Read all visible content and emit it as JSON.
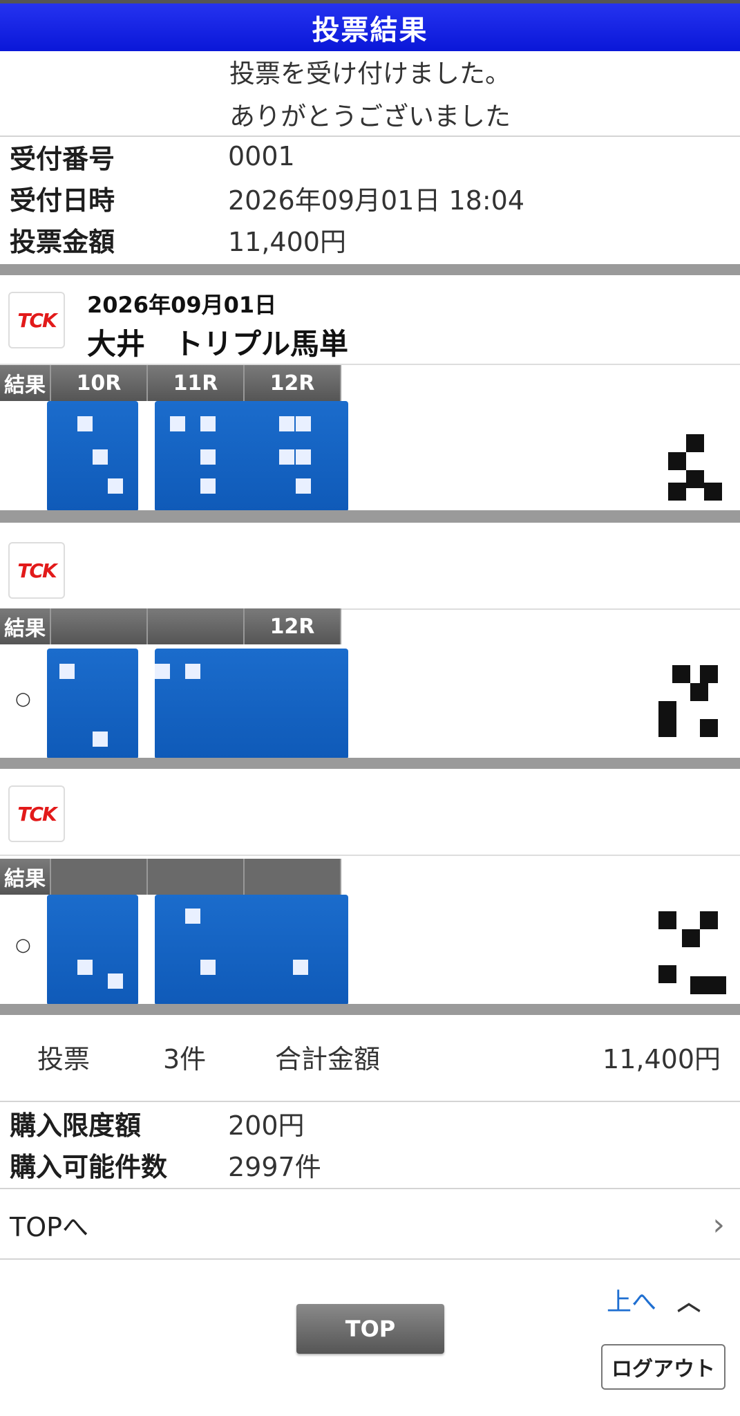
{
  "header": {
    "title": "投票結果"
  },
  "message": {
    "line1": "投票を受け付けました。",
    "line2": "ありがとうございました"
  },
  "receipt": [
    {
      "key": "受付番号",
      "value": "0001"
    },
    {
      "key": "受付日時",
      "value": "2026年09月01日 18:04"
    },
    {
      "key": "投票金額",
      "value": "11,400円"
    }
  ],
  "bets": [
    {
      "logo_text": "TCK",
      "date": "2026年09月01日",
      "title": "大井　トリプル馬単",
      "result_label": "結果",
      "races": [
        "10R",
        "11R",
        "12R"
      ],
      "mark": "",
      "colors": {
        "pick": "#1565c0"
      }
    },
    {
      "logo_text": "TCK",
      "result_label": "結果",
      "races": [
        "",
        "",
        "12R"
      ],
      "mark": "○"
    },
    {
      "logo_text": "TCK",
      "result_label": "結果",
      "mark": "○"
    }
  ],
  "summary": {
    "label": "投票",
    "count": "3件",
    "total_label": "合計金額",
    "total": "11,400円"
  },
  "limits": [
    {
      "key": "購入限度額",
      "value": "200円"
    },
    {
      "key": "購入可能件数",
      "value": "2997件"
    }
  ],
  "nav": {
    "top_link": "TOPへ",
    "up_link": "上へ",
    "top_button": "TOP",
    "logout_button": "ログアウト"
  },
  "icons": {
    "chevron_right": "chevron-right-icon",
    "caret_up": "caret-up-icon"
  },
  "colors": {
    "header": "#0a17d8",
    "link": "#1f6fd1",
    "band": "#9a9a9a"
  }
}
